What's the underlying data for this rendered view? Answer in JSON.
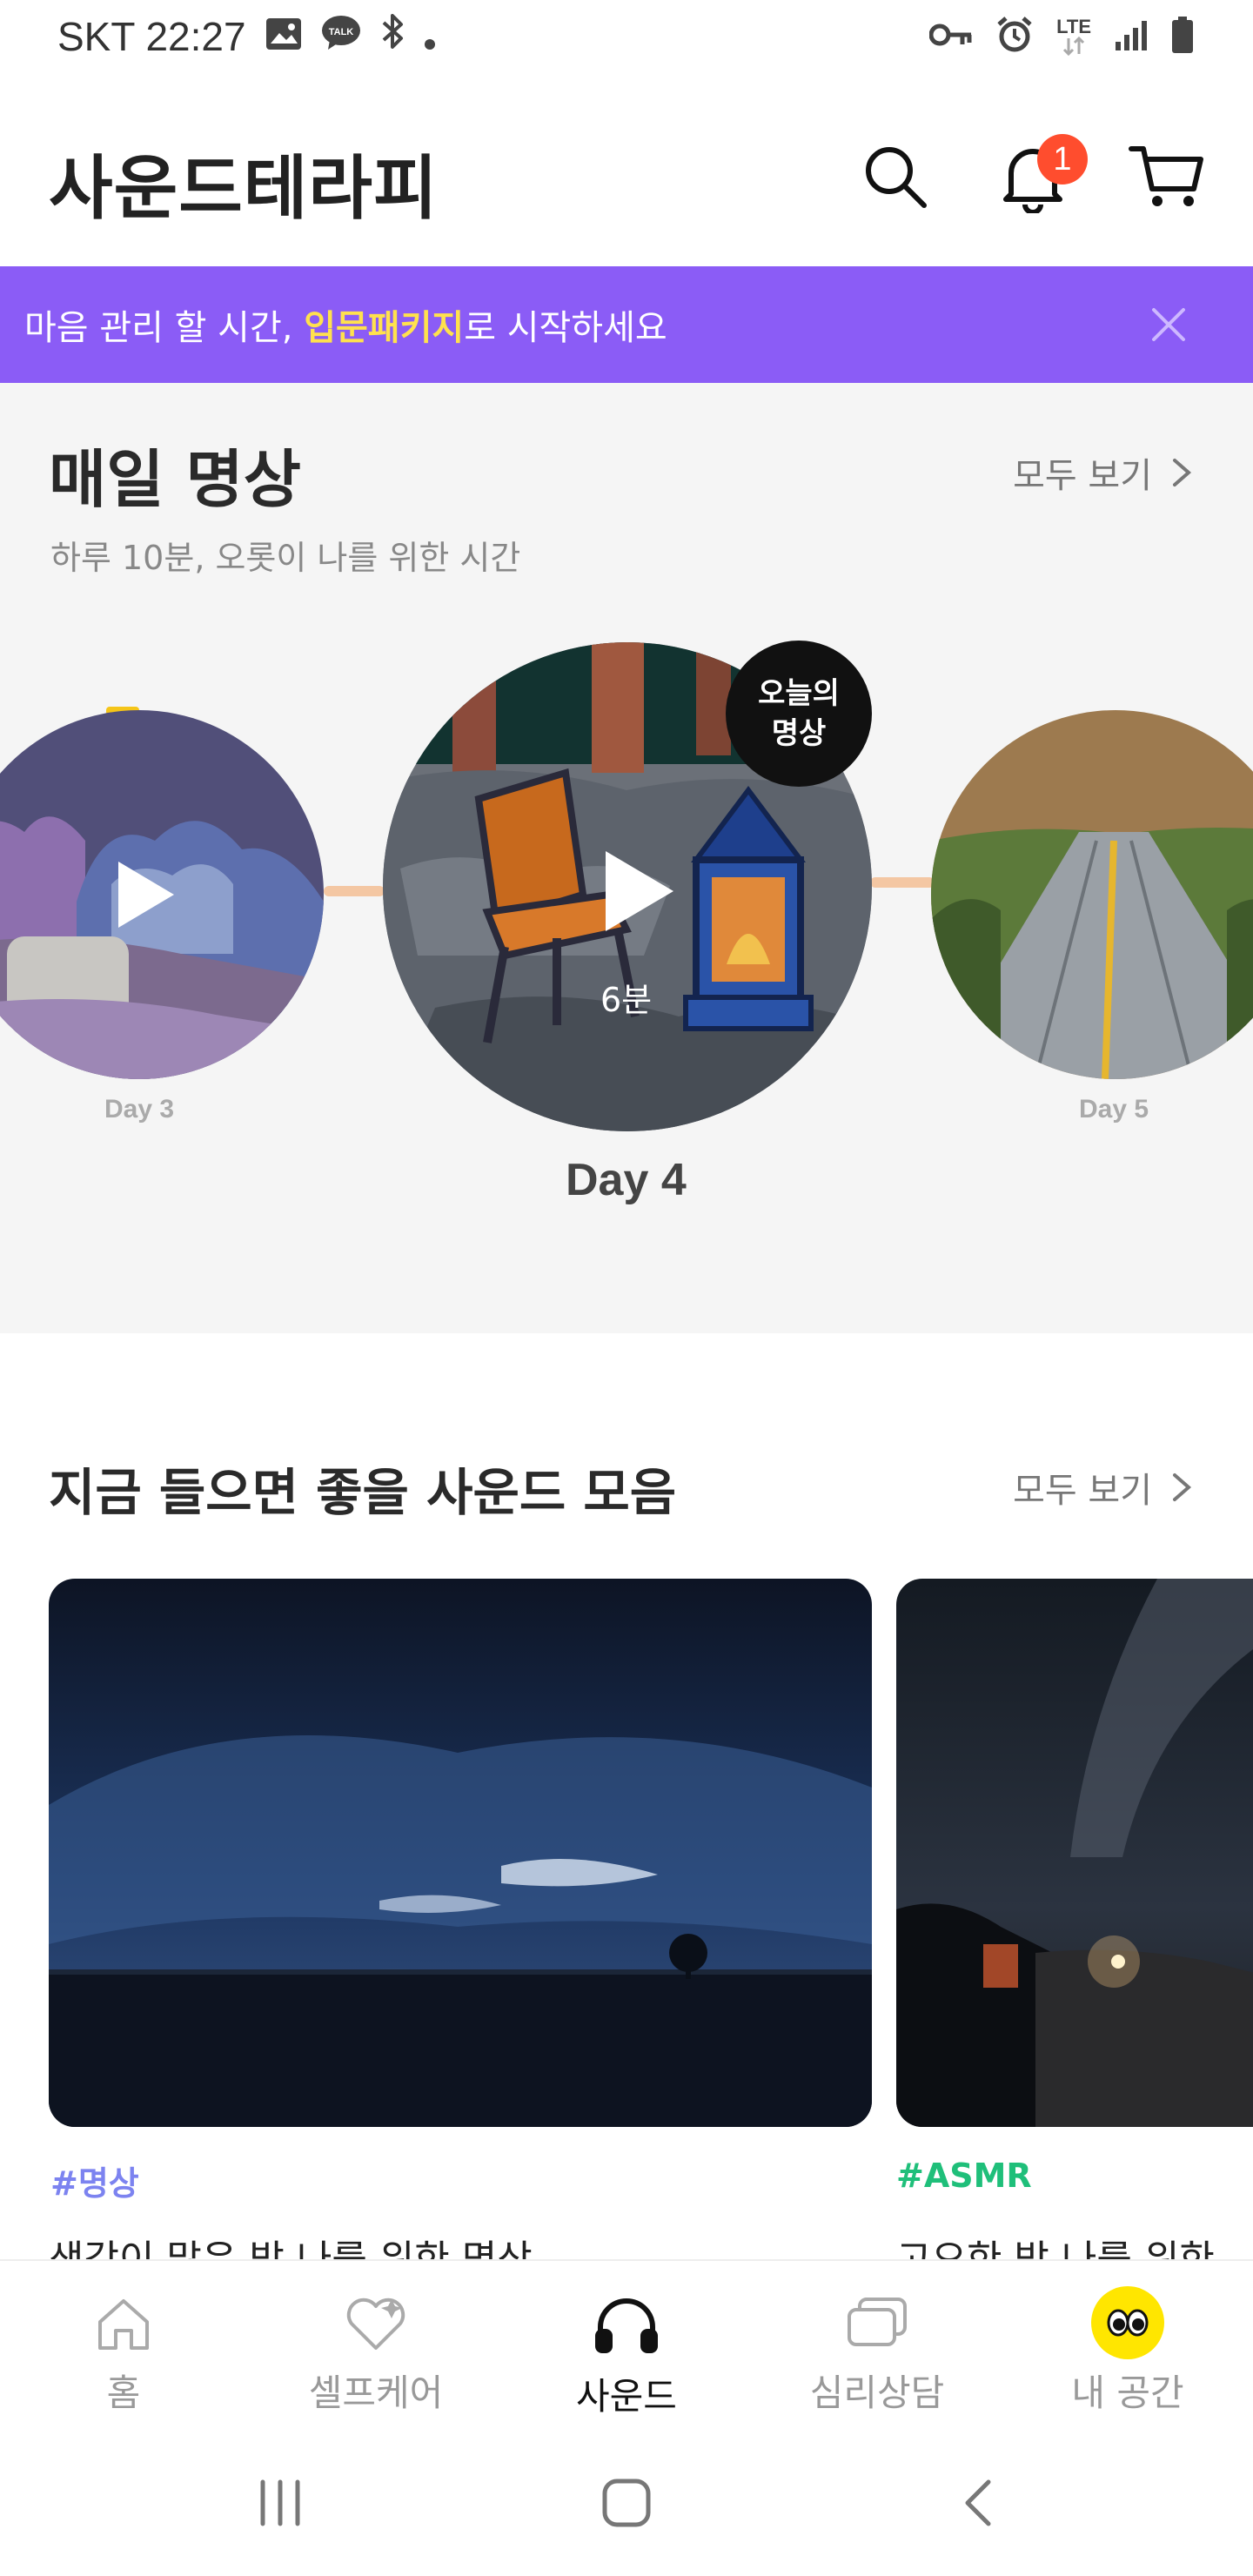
{
  "status_bar": {
    "carrier": "SKT",
    "time": "22:27",
    "network": "LTE"
  },
  "header": {
    "title": "사운드테라피",
    "notification_count": "1"
  },
  "promo": {
    "text_before": "마음 관리 할 시간, ",
    "highlight": "입문패키지",
    "text_after": "로 시작하세요"
  },
  "daily": {
    "title": "매일 명상",
    "subtitle": "하루 10분, 오롯이 나를 위한 시간",
    "see_all": "모두 보기",
    "days": [
      {
        "label": "Day 3"
      },
      {
        "label": "Day 4",
        "duration": "6분",
        "badge_line1": "오늘의",
        "badge_line2": "명상"
      },
      {
        "label": "Day 5"
      }
    ]
  },
  "sounds": {
    "title": "지금 들으면 좋을 사운드 모음",
    "see_all": "모두 보기",
    "cards": [
      {
        "tag": "#명상",
        "title": "생각이 많은 밤 나를 위한 명상"
      },
      {
        "tag": "#ASMR",
        "title": "고요한 밤 나를 위한"
      }
    ]
  },
  "bottom_nav": {
    "items": [
      {
        "label": "홈"
      },
      {
        "label": "셀프케어"
      },
      {
        "label": "사운드"
      },
      {
        "label": "심리상담"
      },
      {
        "label": "내 공간"
      }
    ]
  },
  "colors": {
    "accent_purple": "#8b5cf6",
    "highlight_yellow": "#ffe14d",
    "badge_red": "#ff4d2e",
    "tag_meditation": "#7c83f0",
    "tag_asmr": "#1fbf7a"
  }
}
